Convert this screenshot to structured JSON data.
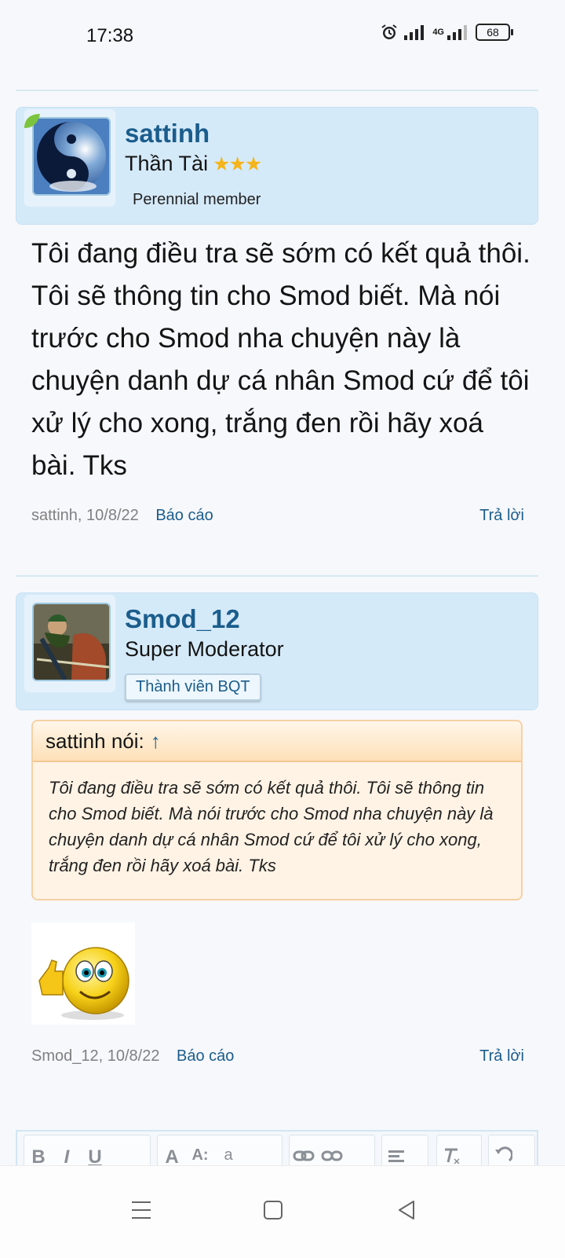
{
  "status": {
    "time": "17:38",
    "battery": "68",
    "network": "4G"
  },
  "posts": [
    {
      "username": "sattinh",
      "title": "Thần Tài",
      "stars": "★★★",
      "extra": "Perennial member",
      "message": "Tôi đang điều tra sẽ sớm có kết quả thôi. Tôi sẽ thông tin cho Smod biết. Mà nói trước cho Smod nha chuyện này là chuyện danh dự cá nhân Smod cứ để tôi xử lý cho xong, trắng đen rồi hãy xoá bài. Tks",
      "meta": "sattinh, 10/8/22",
      "report": "Báo cáo",
      "reply": "Trả lời"
    },
    {
      "username": "Smod_12",
      "title": "Super Moderator",
      "badge": "Thành viên BQT",
      "quote_author": "sattinh nói:",
      "quote_arrow": "↑",
      "quote_text": "Tôi đang điều tra sẽ sớm có kết quả thôi. Tôi sẽ thông tin cho Smod biết. Mà nói trước cho Smod nha chuyện này là chuyện danh dự cá nhân Smod cứ để tôi xử lý cho xong, trắng đen rồi hãy xoá bài. Tks",
      "meta": "Smod_12, 10/8/22",
      "report": "Báo cáo",
      "reply": "Trả lời"
    }
  ],
  "editor": {
    "buttons": [
      "B",
      "I",
      "U",
      "A",
      "A:",
      "a",
      "link-icon",
      "unlink-icon",
      "align-icon",
      "clear-format-icon",
      "undo-icon"
    ]
  },
  "colors": {
    "accent": "#1b5d8c",
    "header_bg": "#d5eaf9",
    "quote_bg": "#fff3e5"
  }
}
